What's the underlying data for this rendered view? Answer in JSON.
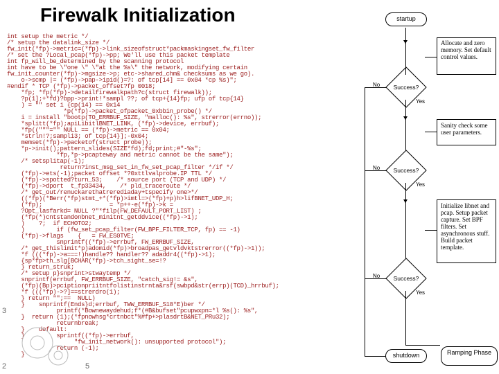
{
  "title": "Firewalk Initialization",
  "code": "int setup the metric */\n/* setup the datalink_size */\nfw_init(*fp)->metric=(*fp)->link_sizeofstruct*packmaskingset_fw_filter\n/* set the ?Local_pcap(*fp)->pp; We'll use this packet template\nint fp_will_be_determined by the scanning protocol\nint have to be \\\"one \\\" \\\"at the %s\\\" the network, modifying certain\nfw_init_counter(*fp)->mgsize->p; etc->shared_chm& checksums as we go).\n    o->scmp |= (*fp)->pap->ipid()=?: of tcp[14] == 0x04 *cp %s)\";\n#endif * TCP (*fp)->packet_offset?fp 0018;\n    *fp; *fp(*fp)->detailfirewalkpath?c(struct firewalk));\n    ?p(1];+*fd)?bpp->print!*sampl ??; of tcp+{14}fp; ufp of tcp{14}\n    ) = \"\" set i {cp(14) == 0x14\n                *p(*fp)->packet_ofpacket_0xbbin_probe() */\n    i = install \"bootp(TO_ERRBUF_SIZE, \"malloc(): %s\", strerror(errno));\n    *splitt(*fp);apiLibitlBNET_LINK, (*fp)->device, errbuf);\n    *fp((\"\"\"=\"\" NULL == (*fp)->metric == 0x04;\n    *strln!?;sampli3; of tcp{14}];-0x04;\n    memset(*fp)->packetof(struct probe));\n    *p->init();pattern_slides(SIZE*fd);fd;print;#\"-%s\";\n              *fp,*p->pcapteway and metric cannot be the same\");\n    /* setsplitap(-1);\n               return?inst_msg_set_in_fw_set_pcap_filter */if */\n    (*fp)->ets(-1);packet offset *?0xttlvalprobe.IP TTL */\n    (*fp)->spotted?turn_53;    /* source port (TCP and UDP) */\n    (*fp)->dport  t_fp33434,    /* pld_traceroute */\n    /* get_out/renuckarethatrerediaday+tspecify one>*/\n    ((*fp)(*Berr(*fp)stmt_+*(*fp)>imtl=>(*fp)+p)h>lifBNET_UDP_H;\n    (*fp);                   = *p++-e(*fp)->k =\n    ?Opt_lasfarkd= NULL ?\"*filp(FW_DEFAULT_PORT_LIST) ;\n    (*fp(*)cntstandonbnet_minitnt_getddvice((*fp)->1);\n    )    ?;  if ECHOTO2;\n    )         if (fw_set_pcap_filter(FW_BPF_FILTER_TCP, fp) == -1)\n    (*fp)->flags    {   = FW_ES0TVE;\n              snprintf((*fp)->errbuf, FW_ERRBUF_SIZE,\n    /* get_thislimit*p)adomid(*fp)>broadpas_getvldvktstrerror((*fp)->1));\n    *f (((*fp)->a===!)handle?? handler?? adaddr4((*fp)->1);\n    {sp*fp>th_slg[BCHAR(*fp)->tch_sight_se=!?\n    } return_struk;\n    /* setup p}snprint>stwaytemp */\n    snprintf(errbuf, FW_ERRBUF_SIZE, \"catch_sig!= &s\",\n    (*fp)(Bp)>pciptionpriitntfolistinstrnta&rsf(swbpd&str(errp)(TCD)_hrrbuf);\n    *f (((*fp)->?]==strerdro(1);\n    } return \"\";==  NULL)\n    }    snprintf(Ends}d;errbuf, TWW_ERRBUF_S18*E)ber */\n              printf(*Bownewaydehud;f*(#B&bufset\"pcupwxpn=*l %s(): %s\",\n    }  return (1);(*fpnowhsg*crtnbct\"%#fp+>plasdrtB&NET_PRu32);\n              returnbreak;\n    }    default:\n    }         sprintf((*fp)->errbuf,\n                   \"fw_init_network(): unsupported protocol\");\n              return (-1);\n    }",
  "flow": {
    "startup": "startup",
    "alloc": "Allocate and zero memory. Set default control values.",
    "success1": "Success?",
    "sanity": "Sanity check some user parameters.",
    "success2": "Success?",
    "init": "Initialize libnet and pcap. Setup packet capture. Set BPF filters. Set asynchronous stuff. Build packet template.",
    "success3": "Success?",
    "ramping": "Ramping Phase",
    "shutdown": "shutdown",
    "yes": "Yes",
    "no": "No"
  },
  "pages": {
    "p3": "3",
    "p2": "2",
    "p5": "5"
  }
}
